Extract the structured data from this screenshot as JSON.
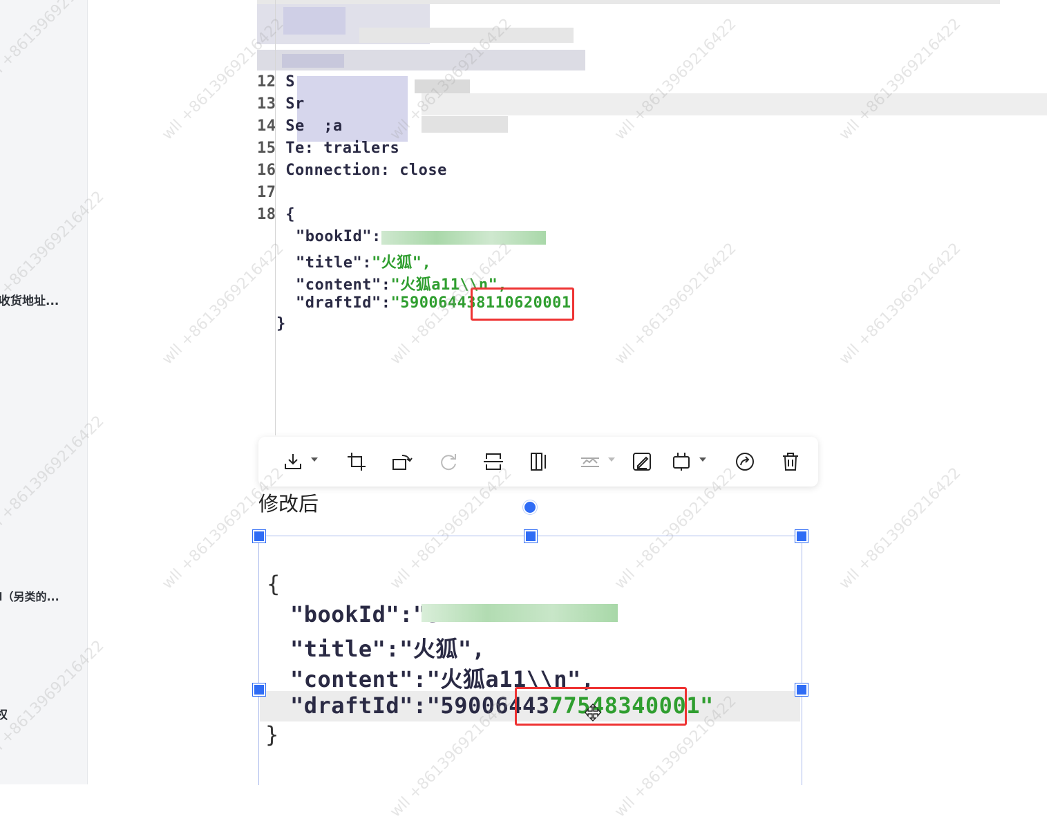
{
  "sidebar": {
    "items": [
      {
        "label": "收货地址..."
      },
      {
        "label": "d（另类的..."
      },
      {
        "label": "权"
      }
    ]
  },
  "top_code": {
    "lines": [
      {
        "num": "15",
        "text": "Te: trailers"
      },
      {
        "num": "16",
        "text": "Connection: close"
      },
      {
        "num": "17",
        "text": ""
      },
      {
        "num": "18",
        "text": "{"
      }
    ],
    "partial_lines": [
      {
        "num": "12",
        "text": "S"
      },
      {
        "num": "13",
        "text": "Sr"
      },
      {
        "num": "14",
        "text": "Se  ;a"
      }
    ],
    "json_keys": {
      "book_id": "\"bookId\":",
      "title": "\"title\":",
      "title_value": "\"火狐\",",
      "content": "\"content\":",
      "content_value": "\"火狐a11\\\\n\",",
      "draft_id": "\"draftId\":",
      "draft_id_value_prefix": "\"59006443",
      "draft_id_value_highlight": "8110620001"
    },
    "closing": "}"
  },
  "toolbar": {
    "buttons": [
      {
        "icon": "download-icon"
      },
      {
        "icon": "crop-icon"
      },
      {
        "icon": "rotate-icon"
      },
      {
        "icon": "redo-icon"
      },
      {
        "icon": "flip-vertical-icon"
      },
      {
        "icon": "flip-horizontal-icon"
      },
      {
        "icon": "image-adjust-icon"
      },
      {
        "icon": "edit-icon"
      },
      {
        "icon": "frame-icon"
      },
      {
        "icon": "share-icon"
      },
      {
        "icon": "delete-icon"
      }
    ]
  },
  "caption": "修改后",
  "bottom_code": {
    "open": "{",
    "book_id": "\"bookId\":\"3",
    "title": "\"title\":\"火狐\",",
    "content": "\"content\":\"火狐a11\\\\n\",",
    "draft_id_prefix": "\"draftId\":\"59006443",
    "draft_id_highlight": "77548340001\"",
    "close": "}"
  },
  "watermark": "wll +8613969216422",
  "colors": {
    "accent": "#2f6cf5",
    "red_box": "#e33333",
    "json_green": "#2f9e2f"
  }
}
